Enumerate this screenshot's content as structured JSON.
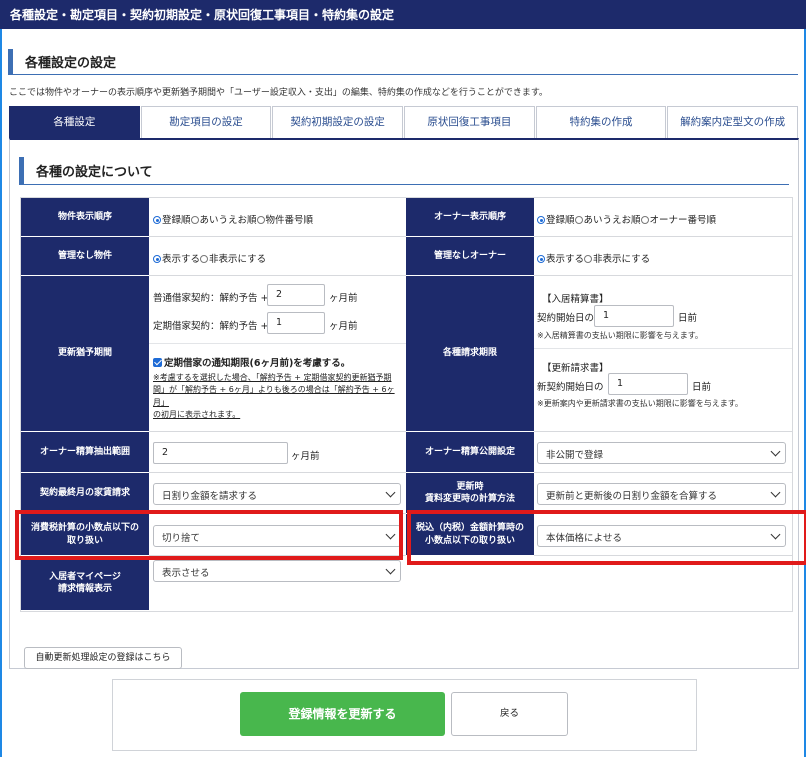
{
  "window": {
    "title": "各種設定・勘定項目・契約初期設定・原状回復工事項目・特約集の設定"
  },
  "section": {
    "title": "各種設定の設定",
    "description": "ここでは物件やオーナーの表示順序や更新猶予期間や「ユーザー設定収入・支出」の編集、特約集の作成などを行うことができます。"
  },
  "tabs": [
    {
      "label": "各種設定",
      "active": true
    },
    {
      "label": "勘定項目の設定",
      "active": false
    },
    {
      "label": "契約初期設定の設定",
      "active": false
    },
    {
      "label": "原状回復工事項目",
      "active": false
    },
    {
      "label": "特約集の作成",
      "active": false
    },
    {
      "label": "解約案内定型文の作成",
      "active": false
    }
  ],
  "subsection": {
    "title": "各種の設定について"
  },
  "settings": {
    "property_order": {
      "label": "物件表示順序",
      "options": [
        "登録順",
        "あいうえお順",
        "物件番号順"
      ],
      "selected": 0
    },
    "owner_order": {
      "label": "オーナー表示順序",
      "options": [
        "登録順",
        "あいうえお順",
        "オーナー番号順"
      ],
      "selected": 0
    },
    "unmanaged_property": {
      "label": "管理なし物件",
      "options": [
        "表示する",
        "非表示にする"
      ],
      "selected": 0
    },
    "unmanaged_owner": {
      "label": "管理なしオーナー",
      "options": [
        "表示する",
        "非表示にする"
      ],
      "selected": 0
    },
    "renewal_grace": {
      "label": "更新猶予期間",
      "normal_prefix": "普通借家契約：解約予告 +",
      "normal_value": "2",
      "fixed_prefix": "定期借家契約：解約予告 +",
      "fixed_value": "1",
      "unit": "ヶ月前",
      "checkbox_label": "定期借家の通知期限(6ヶ月前)を考慮する。",
      "checked": true,
      "note_lines": [
        "※考慮するを選択した場合、「解約予告 + 定期借家契約更新猶予期",
        "間」が「解約予告 + 6ヶ月」よりも後ろの場合は「解約予告 + 6ヶ月」",
        "の初月に表示されます。"
      ]
    },
    "billing_period": {
      "label": "各種請求期限",
      "move_in_title": "【入居精算書】",
      "move_in_prefix": "契約開始日の",
      "move_in_value": "1",
      "move_in_unit": "日前",
      "move_in_note": "※入居精算書の支払い期限に影響を与えます。",
      "renewal_title": "【更新請求書】",
      "renewal_prefix": "新契約開始日の",
      "renewal_value": "1",
      "renewal_unit": "日前",
      "renewal_note": "※更新案内や更新請求書の支払い期限に影響を与えます。"
    },
    "owner_extract": {
      "label": "オーナー精算抽出範囲",
      "value": "2",
      "unit": "ヶ月前"
    },
    "owner_publish": {
      "label": "オーナー精算公開設定",
      "selected": "非公開で登録"
    },
    "last_month_rent": {
      "label": "契約最終月の家賃請求",
      "selected": "日割り金額を請求する"
    },
    "renewal_calc": {
      "label_line1": "更新時",
      "label_line2": "賃料変更時の計算方法",
      "selected": "更新前と更新後の日割り金額を合算する"
    },
    "tax_rounding": {
      "label_line1": "消費税計算の小数点以下の",
      "label_line2": "取り扱い",
      "selected": "切り捨て"
    },
    "tax_inclusive_rounding": {
      "label_line1": "税込（内税）金額計算時の",
      "label_line2": "小数点以下の取り扱い",
      "selected": "本体価格によせる"
    },
    "tenant_mypage": {
      "label_line1": "入居者マイページ",
      "label_line2": "請求情報表示",
      "selected": "表示させる"
    }
  },
  "auto_update_button": "自動更新処理設定の登録はこちら",
  "footer": {
    "update_button": "登録情報を更新する",
    "back_button": "戻る"
  },
  "colors": {
    "header_navy": "#1d2a6b",
    "accent_blue": "#3d6fb4",
    "update_green": "#48b74d",
    "highlight_red": "#e01a1a"
  }
}
